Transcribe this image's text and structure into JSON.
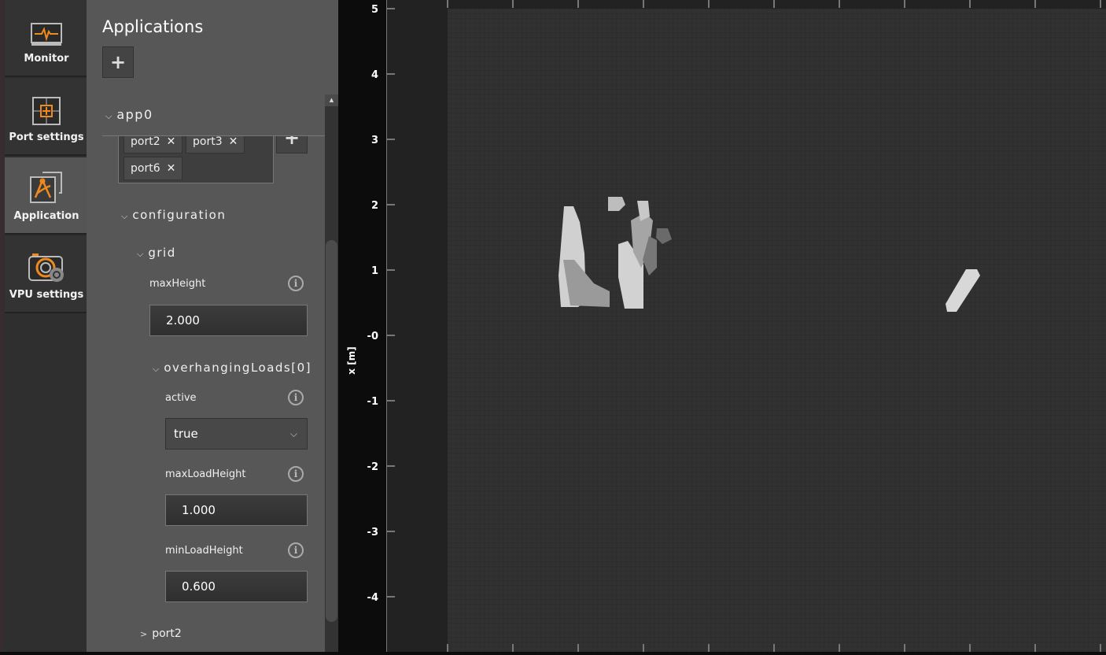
{
  "sidebar": {
    "items": [
      {
        "label": "Monitor",
        "icon": "monitor-icon"
      },
      {
        "label": "Port settings",
        "icon": "port-settings-icon"
      },
      {
        "label": "Application",
        "icon": "application-icon",
        "active": true
      },
      {
        "label": "VPU settings",
        "icon": "vpu-settings-icon"
      }
    ]
  },
  "accent": "#f08a1c",
  "panel": {
    "title": "Applications",
    "add_label": "+",
    "app": {
      "name": "app0",
      "ports": [
        "port2",
        "port3",
        "port6"
      ],
      "remove_symbol": "✕",
      "add_port_label": "+"
    },
    "configuration": "configuration",
    "grid": "grid",
    "maxHeight": {
      "label": "maxHeight",
      "value": "2.000"
    },
    "overhanging": "overhangingLoads[0]",
    "active": {
      "label": "active",
      "value": "true"
    },
    "maxLoadHeight": {
      "label": "maxLoadHeight",
      "value": "1.000"
    },
    "minLoadHeight": {
      "label": "minLoadHeight",
      "value": "0.600"
    },
    "port2": "port2",
    "info_symbol": "i",
    "collapse_symbol": "⌵",
    "expand_symbol": ">"
  },
  "plot": {
    "ylabel": "x [m]",
    "yticks": [
      "5",
      "4",
      "3",
      "2",
      "1",
      "-0",
      "-1",
      "-2",
      "-3",
      "-4"
    ]
  }
}
